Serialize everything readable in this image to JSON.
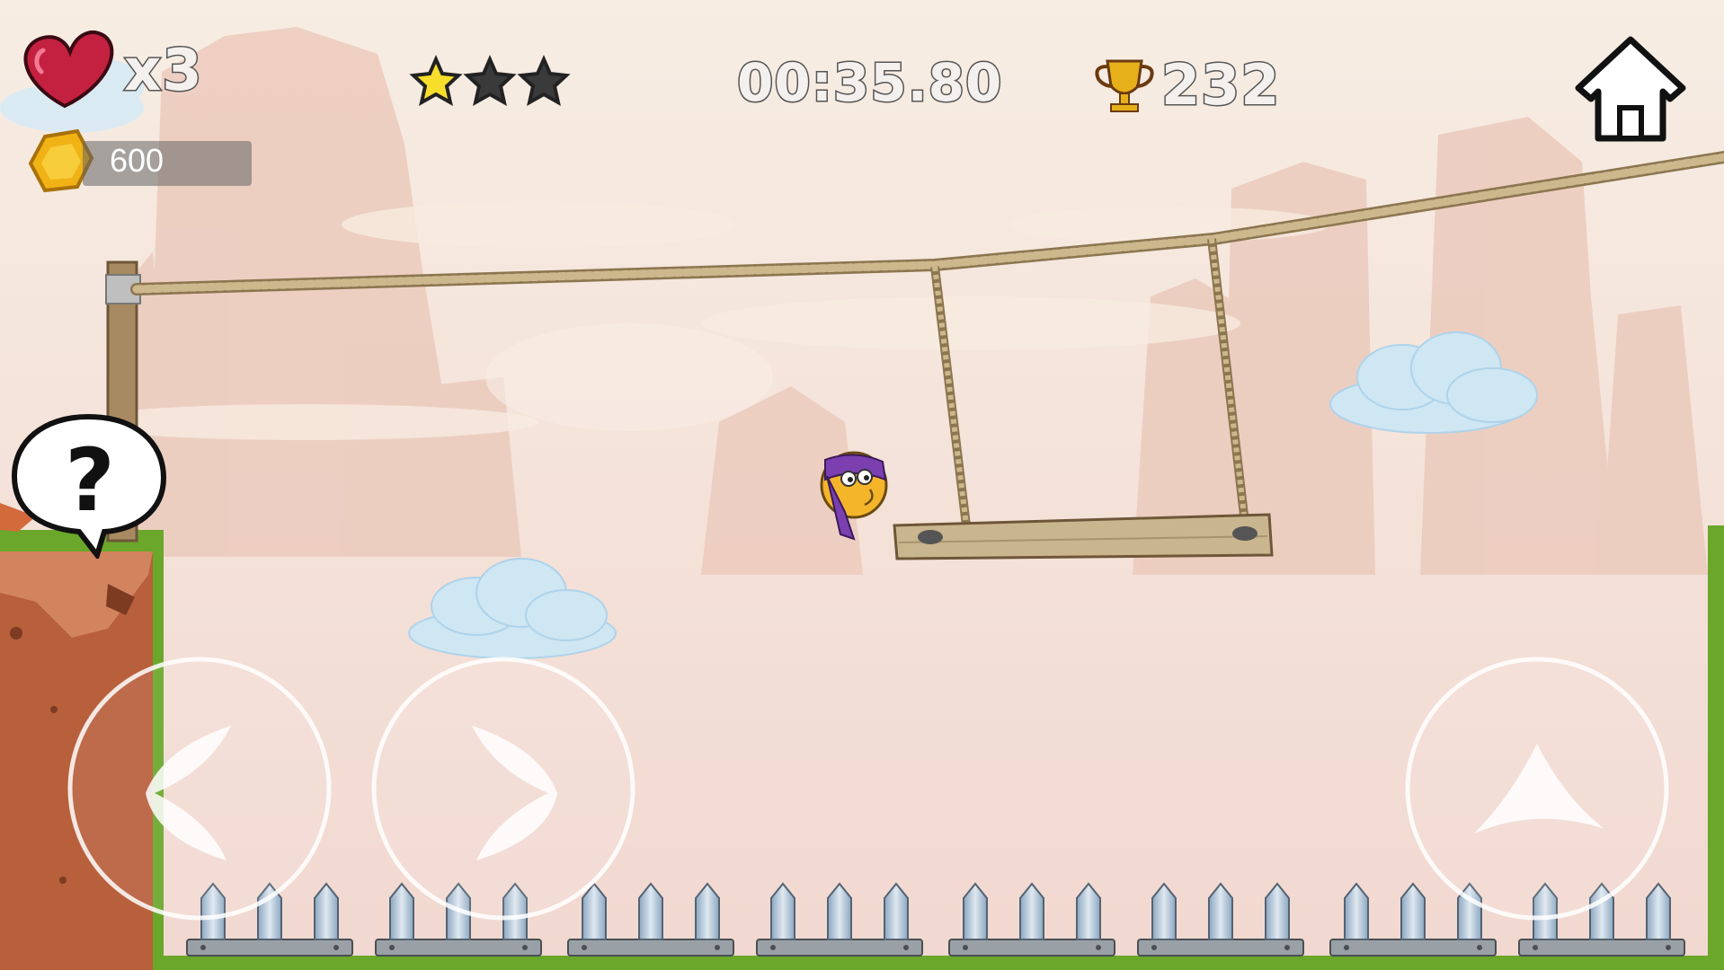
{
  "hud": {
    "lives": "x3",
    "timer": "00:35.80",
    "score": "232",
    "coins": "600",
    "stars_earned": 1,
    "stars_total": 3
  },
  "icons": {
    "lives": "heart-icon",
    "coins": "hex-coin-icon",
    "score": "trophy-icon",
    "home": "home-icon",
    "help": "question-bubble-icon",
    "left": "left-arrow-icon",
    "right": "right-arrow-icon",
    "jump": "up-arrow-icon"
  },
  "colors": {
    "sky": "#f2dfd2",
    "grass": "#6aa72b",
    "dirt": "#b85f3b",
    "rope": "#b8a27a",
    "wood": "#c9b58e",
    "star_gold": "#f7de2b",
    "heart": "#c4203f",
    "trophy": "#e6b01a"
  }
}
